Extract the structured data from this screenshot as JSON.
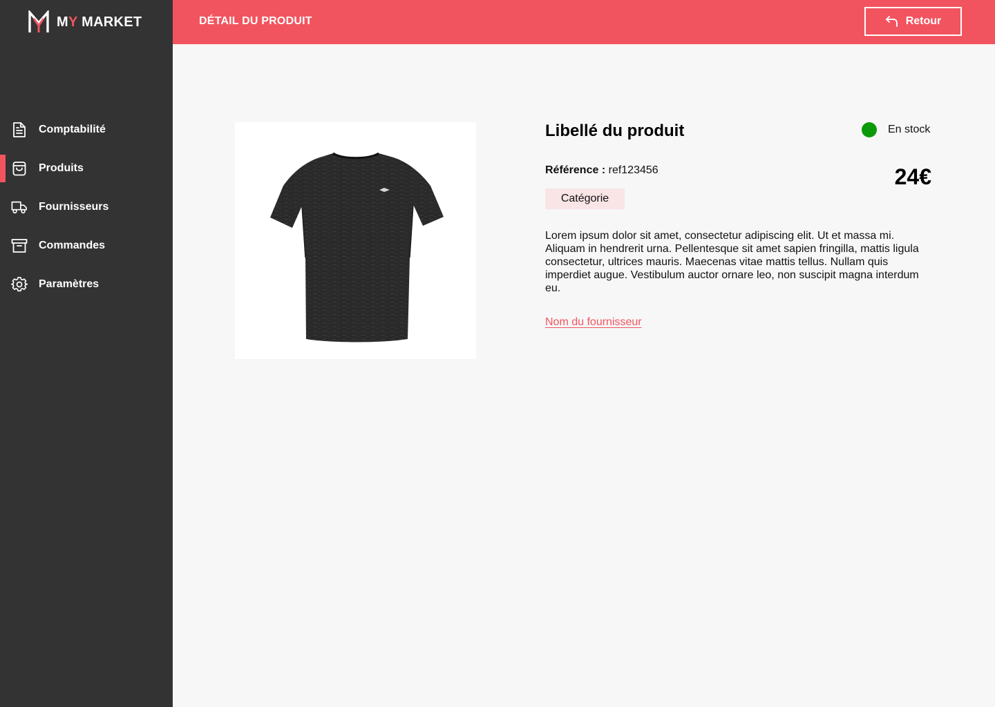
{
  "app": {
    "brand_prefix": "M",
    "brand_accent": "Y",
    "brand_suffix": " MARKET",
    "accent_color": "#f2545f"
  },
  "sidebar": {
    "items": [
      {
        "label": "Comptabilité",
        "icon": "document-icon",
        "active": false
      },
      {
        "label": "Produits",
        "icon": "shopping-bag-icon",
        "active": true
      },
      {
        "label": "Fournisseurs",
        "icon": "truck-icon",
        "active": false
      },
      {
        "label": "Commandes",
        "icon": "archive-box-icon",
        "active": false
      },
      {
        "label": "Paramètres",
        "icon": "gear-icon",
        "active": false
      }
    ]
  },
  "header": {
    "title": "DÉTAIL DU PRODUIT",
    "back_label": "Retour"
  },
  "product": {
    "image_icon": "tshirt-icon",
    "title": "Libellé du produit",
    "stock_status": "En stock",
    "stock_color": "#0a9a0a",
    "reference_label": "Référence :",
    "reference_value": "ref123456",
    "price": "24€",
    "category": "Catégorie",
    "description": "Lorem ipsum dolor sit amet, consectetur adipiscing elit. Ut et massa mi. Aliquam in hendrerit urna. Pellentesque sit amet sapien fringilla, mattis ligula consectetur, ultrices mauris. Maecenas vitae mattis tellus. Nullam quis imperdiet augue. Vestibulum auctor ornare leo, non suscipit magna interdum eu.",
    "supplier_link": "Nom du fournisseur"
  }
}
